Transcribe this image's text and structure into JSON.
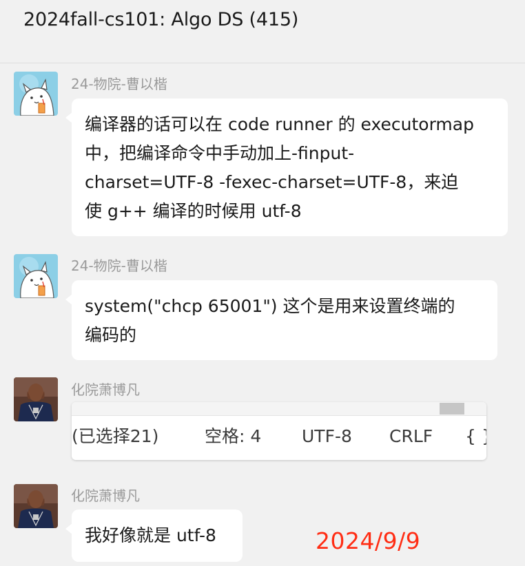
{
  "chat": {
    "title": "2024fall-cs101: Algo DS  (415)"
  },
  "messages": [
    {
      "sender": "24-物院-曹以楷",
      "lines": [
        "编译器的话可以在 code runner 的 executormap",
        "中，把编译命令中手动加上-finput-",
        "charset=UTF-8 -fexec-charset=UTF-8，来迫",
        "使 g++ 编译的时候用 utf-8"
      ]
    },
    {
      "sender": "24-物院-曹以楷",
      "lines": [
        "system(\"chcp 65001\") 这个是用来设置终端的",
        "编码的"
      ]
    },
    {
      "sender": "化院萧博凡",
      "image": {
        "status_items": [
          "(已选择21)",
          "空格: 4",
          "UTF-8",
          "CRLF",
          "{ }"
        ]
      }
    },
    {
      "sender": "化院萧博凡",
      "lines": [
        "我好像就是 utf-8"
      ]
    }
  ],
  "watermark": {
    "date": "2024/9/9",
    "color": "#ff2d14"
  },
  "colors": {
    "background": "#f1f1f1",
    "bubble": "#ffffff",
    "sender_name": "#9a9a9a"
  },
  "icons": {
    "avatar_1": "cartoon-cat-avatar",
    "avatar_2": "basketball-player-avatar"
  }
}
